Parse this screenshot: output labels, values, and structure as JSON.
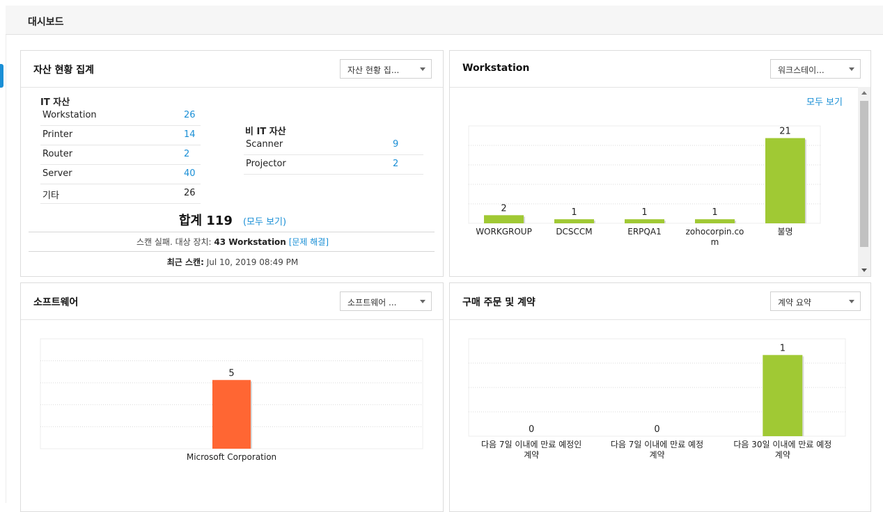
{
  "page": {
    "title": "대시보드"
  },
  "asset_summary": {
    "title": "자산 현황 집계",
    "dropdown": "자산 현황 집...",
    "it_heading": "IT 자산",
    "it_items": [
      {
        "name": "Workstation",
        "count": "26"
      },
      {
        "name": "Printer",
        "count": "14"
      },
      {
        "name": "Router",
        "count": "2"
      },
      {
        "name": "Server",
        "count": "40"
      },
      {
        "name": "기타",
        "count": "26"
      }
    ],
    "non_it_heading": "비 IT 자산",
    "non_it_items": [
      {
        "name": "Scanner",
        "count": "9"
      },
      {
        "name": "Projector",
        "count": "2"
      }
    ],
    "total_label": "합계 119",
    "view_all": "(모두 보기)",
    "scan_fail_prefix": "스캔 실패. 대상 장치: ",
    "scan_fail_count": "43 Workstation",
    "scan_fail_link": "[문제 해결]",
    "last_scan_label": "최근 스캔:",
    "last_scan_value": " Jul 10, 2019 08:49 PM"
  },
  "workstation": {
    "title": "Workstation",
    "dropdown": "워크스테이...",
    "view_all": "모두 보기"
  },
  "software": {
    "title": "소프트웨어",
    "dropdown": "소프트웨어 ..."
  },
  "purchase": {
    "title": "구매 주문 및 계약",
    "dropdown": "계약 요약"
  },
  "colors": {
    "accent": "#1a8fd6",
    "green_bar": "#a0c934",
    "orange_bar": "#ff6633",
    "grid": "#d9d9d9"
  },
  "chart_data": [
    {
      "id": "workstation",
      "type": "bar",
      "categories": [
        "WORKGROUP",
        "DCSCCM",
        "ERPQA1",
        "zohocorpin.com",
        "불명"
      ],
      "category_lines": [
        [
          "WORKGROUP"
        ],
        [
          "DCSCCM"
        ],
        [
          "ERPQA1"
        ],
        [
          "zohocorpin.co",
          "m"
        ],
        [
          "불명"
        ]
      ],
      "values": [
        2,
        1,
        1,
        1,
        21
      ],
      "ylim": [
        0,
        24
      ],
      "grid": true,
      "color": "#a0c934"
    },
    {
      "id": "software",
      "type": "bar",
      "categories": [
        "Microsoft Corporation"
      ],
      "category_lines": [
        [
          "Microsoft Corporation"
        ]
      ],
      "values": [
        5
      ],
      "ylim": [
        0,
        8
      ],
      "grid": true,
      "color": "#ff6633"
    },
    {
      "id": "purchase",
      "type": "bar",
      "categories": [
        "다음 7일 이내에 만료 예정인 계약",
        "다음 7일 이내에 만료 예정 계약",
        "다음 30일 이내에 만료 예정 계약"
      ],
      "category_lines": [
        [
          "다음 7일 이내에 만료 예정인",
          "계약"
        ],
        [
          "다음 7일 이내에 만료 예정",
          "계약"
        ],
        [
          "다음 30일 이내에 만료 예정",
          "계약"
        ]
      ],
      "values": [
        0,
        0,
        1
      ],
      "ylim": [
        0,
        1.2
      ],
      "grid": true,
      "color": "#a0c934"
    }
  ]
}
